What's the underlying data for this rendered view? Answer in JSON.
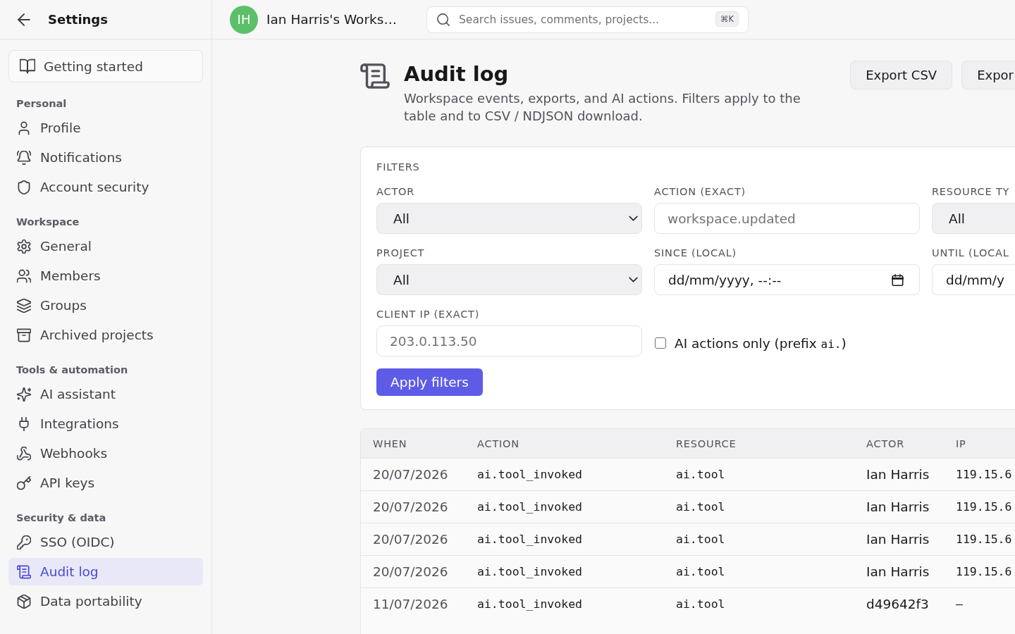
{
  "sidebar": {
    "title": "Settings",
    "getting_started": "Getting started",
    "sections": [
      {
        "heading": "Personal",
        "items": [
          {
            "label": "Profile",
            "selected": false
          },
          {
            "label": "Notifications",
            "selected": false
          },
          {
            "label": "Account security",
            "selected": false
          }
        ]
      },
      {
        "heading": "Workspace",
        "items": [
          {
            "label": "General",
            "selected": false
          },
          {
            "label": "Members",
            "selected": false
          },
          {
            "label": "Groups",
            "selected": false
          },
          {
            "label": "Archived projects",
            "selected": false
          }
        ]
      },
      {
        "heading": "Tools & automation",
        "items": [
          {
            "label": "AI assistant",
            "selected": false
          },
          {
            "label": "Integrations",
            "selected": false
          },
          {
            "label": "Webhooks",
            "selected": false
          },
          {
            "label": "API keys",
            "selected": false
          }
        ]
      },
      {
        "heading": "Security & data",
        "items": [
          {
            "label": "SSO (OIDC)",
            "selected": false
          },
          {
            "label": "Audit log",
            "selected": true
          },
          {
            "label": "Data portability",
            "selected": false
          }
        ]
      }
    ]
  },
  "topbar": {
    "avatar": "IH",
    "workspace": "Ian Harris's Works…",
    "search": {
      "placeholder": "Search issues, comments, projects...",
      "shortcut": "⌘K"
    }
  },
  "page": {
    "title": "Audit log",
    "description": "Workspace events, exports, and AI actions. Filters apply to the table and to CSV / NDJSON download.",
    "buttons": [
      "Export CSV",
      "Expor"
    ]
  },
  "filters": {
    "heading": "FILTERS",
    "fields": [
      {
        "kind": "select",
        "label": "ACTOR",
        "value": "All"
      },
      {
        "kind": "text",
        "label": "ACTION (EXACT)",
        "placeholder": "workspace.updated"
      },
      {
        "kind": "select",
        "label": "RESOURCE TY",
        "value": "All"
      },
      {
        "kind": "select",
        "label": "PROJECT",
        "value": "All"
      },
      {
        "kind": "date",
        "label": "SINCE (LOCAL)",
        "value": "dd/mm/yyyy, --:--"
      },
      {
        "kind": "date",
        "label": "UNTIL (LOCAL",
        "value": "dd/mm/y"
      },
      {
        "kind": "text",
        "label": "CLIENT IP (EXACT)",
        "placeholder": "203.0.113.50"
      }
    ],
    "checkbox": {
      "parts": [
        {
          "kind": "text",
          "text": "AI actions only (prefix "
        },
        {
          "kind": "code",
          "text": "ai."
        },
        {
          "kind": "text",
          "text": ")"
        }
      ],
      "checked": false
    },
    "apply_button": "Apply filters"
  },
  "table": {
    "columns": [
      "WHEN",
      "ACTION",
      "RESOURCE",
      "ACTOR",
      "IP"
    ],
    "rows": [
      [
        "20/07/2026",
        "ai.tool_invoked",
        "ai.tool",
        "Ian Harris",
        "119.15.6"
      ],
      [
        "20/07/2026",
        "ai.tool_invoked",
        "ai.tool",
        "Ian Harris",
        "119.15.6"
      ],
      [
        "20/07/2026",
        "ai.tool_invoked",
        "ai.tool",
        "Ian Harris",
        "119.15.6"
      ],
      [
        "20/07/2026",
        "ai.tool_invoked",
        "ai.tool",
        "Ian Harris",
        "119.15.6"
      ],
      [
        "11/07/2026",
        "ai.tool_invoked",
        "ai.tool",
        "d49642f3",
        "–"
      ]
    ]
  }
}
